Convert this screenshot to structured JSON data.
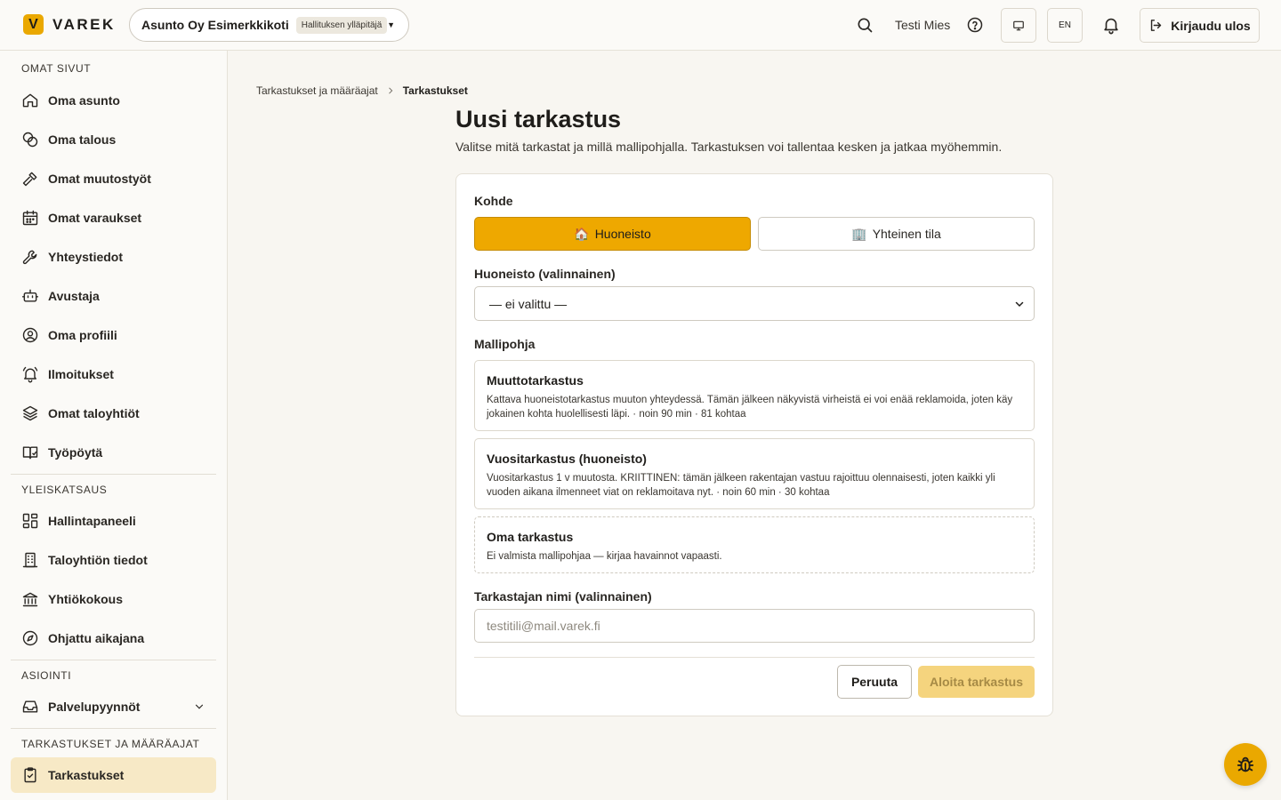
{
  "header": {
    "logo_letter": "V",
    "logo_text": "VAREK",
    "org_name": "Asunto Oy Esimerkkikoti",
    "org_role": "Hallituksen ylläpitäjä",
    "user_name": "Testi Mies",
    "lang": "EN",
    "logout_label": "Kirjaudu ulos"
  },
  "sidebar": {
    "sections": [
      {
        "title": "OMAT SIVUT",
        "items": [
          {
            "label": "Oma asunto",
            "icon": "home-icon"
          },
          {
            "label": "Oma talous",
            "icon": "coins-icon"
          },
          {
            "label": "Omat muutostyöt",
            "icon": "hammer-icon"
          },
          {
            "label": "Omat varaukset",
            "icon": "calendar-icon"
          },
          {
            "label": "Yhteystiedot",
            "icon": "wrench-icon"
          },
          {
            "label": "Avustaja",
            "icon": "bot-icon"
          },
          {
            "label": "Oma profiili",
            "icon": "user-circle-icon"
          },
          {
            "label": "Ilmoitukset",
            "icon": "bell-ring-icon"
          },
          {
            "label": "Omat taloyhtiöt",
            "icon": "layers-icon"
          },
          {
            "label": "Työpöytä",
            "icon": "book-icon"
          }
        ]
      },
      {
        "title": "YLEISKATSAUS",
        "items": [
          {
            "label": "Hallintapaneeli",
            "icon": "dashboard-icon"
          },
          {
            "label": "Taloyhtiön tiedot",
            "icon": "building-icon"
          },
          {
            "label": "Yhtiökokous",
            "icon": "landmark-icon"
          },
          {
            "label": "Ohjattu aikajana",
            "icon": "compass-icon"
          }
        ]
      },
      {
        "title": "ASIOINTI",
        "items": [
          {
            "label": "Palvelupyynnöt",
            "icon": "inbox-icon"
          }
        ]
      },
      {
        "title": "TARKASTUKSET JA MÄÄRÄAJAT",
        "items": [
          {
            "label": "Tarkastukset",
            "icon": "clipboard-check-icon"
          }
        ]
      }
    ]
  },
  "breadcrumb": {
    "parent": "Tarkastukset ja määräajat",
    "current": "Tarkastukset"
  },
  "page": {
    "title": "Uusi tarkastus",
    "description": "Valitse mitä tarkastat ja millä mallipohjalla. Tarkastuksen voi tallentaa kesken ja jatkaa myöhemmin."
  },
  "form": {
    "kohde_label": "Kohde",
    "kohde_options": [
      {
        "emoji": "🏠",
        "label": "Huoneisto",
        "selected": true
      },
      {
        "emoji": "🏢",
        "label": "Yhteinen tila",
        "selected": false
      }
    ],
    "huoneisto_label": "Huoneisto (valinnainen)",
    "huoneisto_value": "— ei valittu —",
    "mallipohja_label": "Mallipohja",
    "templates": [
      {
        "title": "Muuttotarkastus",
        "description": "Kattava huoneistotarkastus muuton yhteydessä. Tämän jälkeen näkyvistä virheistä ei voi enää reklamoida, joten käy jokainen kohta huolellisesti läpi. · noin 90 min · 81 kohtaa"
      },
      {
        "title": "Vuositarkastus (huoneisto)",
        "description": "Vuositarkastus 1 v muutosta. KRIITTINEN: tämän jälkeen rakentajan vastuu rajoittuu olennaisesti, joten kaikki yli vuoden aikana ilmenneet viat on reklamoitava nyt. · noin 60 min · 30 kohtaa"
      },
      {
        "title": "Oma tarkastus",
        "description": "Ei valmista mallipohjaa — kirjaa havainnot vapaasti."
      }
    ],
    "inspector_label": "Tarkastajan nimi (valinnainen)",
    "inspector_placeholder": "testitili@mail.varek.fi",
    "cancel_label": "Peruuta",
    "start_label": "Aloita tarkastus"
  },
  "colors": {
    "accent": "#eea800",
    "accent_disabled": "#f5d47e",
    "active_nav_bg": "#f7e9c6"
  }
}
